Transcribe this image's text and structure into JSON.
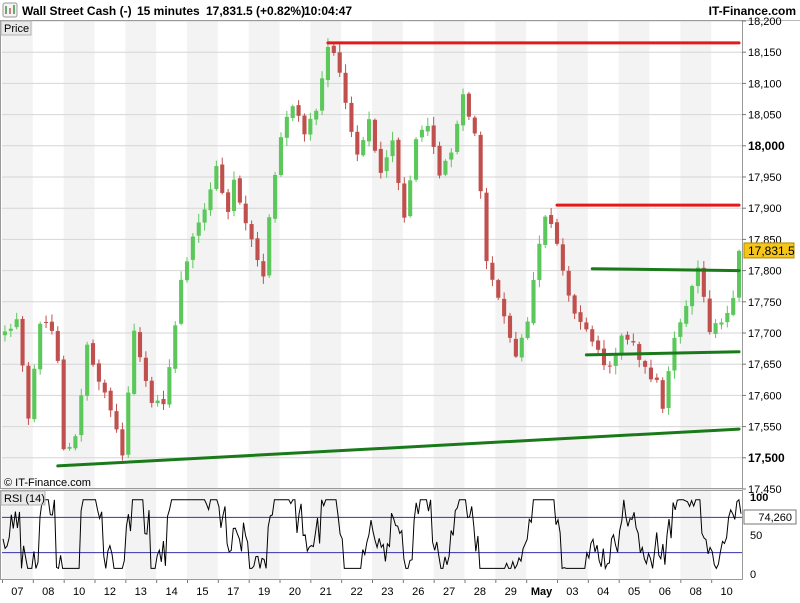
{
  "header": {
    "instrument": "Wall Street Cash (-)",
    "timeframe": "15 minutes",
    "price_change": "17,831.5 (+0.82%)",
    "time": "10:04:47",
    "brand": "IT-Finance.com"
  },
  "price_panel": {
    "label": "Price",
    "copyright": "© IT-Finance.com"
  },
  "rsi_panel": {
    "label": "RSI (14)",
    "current_value_label": "74,260"
  },
  "chart_data": [
    {
      "type": "candlestick",
      "name": "price",
      "y_range": [
        17450,
        18200
      ],
      "y_ticks": [
        {
          "v": 17450,
          "label": "17,450",
          "bold": false
        },
        {
          "v": 17500,
          "label": "17,500",
          "bold": true
        },
        {
          "v": 17550,
          "label": "17,550",
          "bold": false
        },
        {
          "v": 17600,
          "label": "17,600",
          "bold": false
        },
        {
          "v": 17650,
          "label": "17,650",
          "bold": false
        },
        {
          "v": 17700,
          "label": "17,700",
          "bold": false
        },
        {
          "v": 17750,
          "label": "17,750",
          "bold": false
        },
        {
          "v": 17800,
          "label": "17,800",
          "bold": false
        },
        {
          "v": 17850,
          "label": "17,850",
          "bold": false
        },
        {
          "v": 17900,
          "label": "17,900",
          "bold": false
        },
        {
          "v": 17950,
          "label": "17,950",
          "bold": false
        },
        {
          "v": 18000,
          "label": "18,000",
          "bold": true
        },
        {
          "v": 18050,
          "label": "18,050",
          "bold": false
        },
        {
          "v": 18100,
          "label": "18,100",
          "bold": false
        },
        {
          "v": 18150,
          "label": "18,150",
          "bold": false
        },
        {
          "v": 18200,
          "label": "18,200",
          "bold": false
        }
      ],
      "x_labels": [
        {
          "label": "07",
          "bold": false
        },
        {
          "label": "08",
          "bold": false
        },
        {
          "label": "10",
          "bold": false
        },
        {
          "label": "12",
          "bold": false
        },
        {
          "label": "13",
          "bold": false
        },
        {
          "label": "14",
          "bold": false
        },
        {
          "label": "15",
          "bold": false
        },
        {
          "label": "17",
          "bold": false
        },
        {
          "label": "19",
          "bold": false
        },
        {
          "label": "20",
          "bold": false
        },
        {
          "label": "21",
          "bold": false
        },
        {
          "label": "22",
          "bold": false
        },
        {
          "label": "23",
          "bold": false
        },
        {
          "label": "26",
          "bold": false
        },
        {
          "label": "27",
          "bold": false
        },
        {
          "label": "28",
          "bold": false
        },
        {
          "label": "29",
          "bold": false
        },
        {
          "label": "May",
          "bold": true
        },
        {
          "label": "03",
          "bold": false
        },
        {
          "label": "04",
          "bold": false
        },
        {
          "label": "05",
          "bold": false
        },
        {
          "label": "06",
          "bold": false
        },
        {
          "label": "08",
          "bold": false
        },
        {
          "label": "10",
          "bold": false
        }
      ],
      "last_price": 17831.5,
      "last_price_label": "17,831.5",
      "path_knots": [
        [
          0,
          17700
        ],
        [
          2,
          17720
        ],
        [
          4,
          17560
        ],
        [
          6,
          17720
        ],
        [
          8,
          17700
        ],
        [
          9,
          17650
        ],
        [
          10,
          17510
        ],
        [
          12,
          17530
        ],
        [
          14,
          17680
        ],
        [
          17,
          17600
        ],
        [
          20,
          17510
        ],
        [
          22,
          17700
        ],
        [
          25,
          17590
        ],
        [
          27,
          17580
        ],
        [
          30,
          17780
        ],
        [
          32,
          17860
        ],
        [
          34,
          17900
        ],
        [
          36,
          17960
        ],
        [
          38,
          17890
        ],
        [
          39,
          17950
        ],
        [
          41,
          17870
        ],
        [
          43,
          17820
        ],
        [
          44,
          17790
        ],
        [
          45,
          17880
        ],
        [
          47,
          18020
        ],
        [
          49,
          18070
        ],
        [
          51,
          18020
        ],
        [
          53,
          18060
        ],
        [
          55,
          18160
        ],
        [
          56,
          18150
        ],
        [
          58,
          18070
        ],
        [
          60,
          17990
        ],
        [
          62,
          18040
        ],
        [
          64,
          17960
        ],
        [
          66,
          18010
        ],
        [
          68,
          17880
        ],
        [
          70,
          18010
        ],
        [
          72,
          18030
        ],
        [
          74,
          17960
        ],
        [
          76,
          17990
        ],
        [
          78,
          18080
        ],
        [
          80,
          18020
        ],
        [
          82,
          17820
        ],
        [
          84,
          17750
        ],
        [
          86,
          17700
        ],
        [
          87,
          17660
        ],
        [
          89,
          17720
        ],
        [
          91,
          17840
        ],
        [
          92,
          17890
        ],
        [
          93,
          17870
        ],
        [
          95,
          17800
        ],
        [
          97,
          17730
        ],
        [
          99,
          17700
        ],
        [
          101,
          17670
        ],
        [
          103,
          17640
        ],
        [
          105,
          17700
        ],
        [
          107,
          17680
        ],
        [
          109,
          17640
        ],
        [
          111,
          17620
        ],
        [
          112,
          17580
        ],
        [
          114,
          17700
        ],
        [
          116,
          17740
        ],
        [
          118,
          17800
        ],
        [
          120,
          17700
        ],
        [
          122,
          17720
        ],
        [
          124,
          17760
        ],
        [
          125,
          17835
        ]
      ],
      "trendlines": [
        {
          "color": "#e31a1c",
          "x1": 55,
          "y1": 18165,
          "x2": 125,
          "y2": 18165
        },
        {
          "color": "#e31a1c",
          "x1": 94,
          "y1": 17905,
          "x2": 125,
          "y2": 17905
        },
        {
          "color": "#1a7a1a",
          "x1": 100,
          "y1": 17803,
          "x2": 125,
          "y2": 17800
        },
        {
          "color": "#1a7a1a",
          "x1": 99,
          "y1": 17665,
          "x2": 125,
          "y2": 17670
        },
        {
          "color": "#1a7a1a",
          "x1": 9,
          "y1": 17487,
          "x2": 125,
          "y2": 17546
        }
      ],
      "colors": {
        "up": "#5cc85c",
        "down": "#c0504d",
        "last_price_bg": "#f5c518"
      }
    },
    {
      "type": "line",
      "name": "RSI (14)",
      "y_range": [
        0,
        100
      ],
      "y_ticks": [
        {
          "v": 0,
          "label": "0"
        },
        {
          "v": 50,
          "label": "50"
        },
        {
          "v": 100,
          "label": "100"
        }
      ],
      "levels": [
        30,
        70
      ],
      "last_value": 74.26,
      "colors": {
        "line": "#000000",
        "levels": "#3333aa"
      }
    }
  ]
}
